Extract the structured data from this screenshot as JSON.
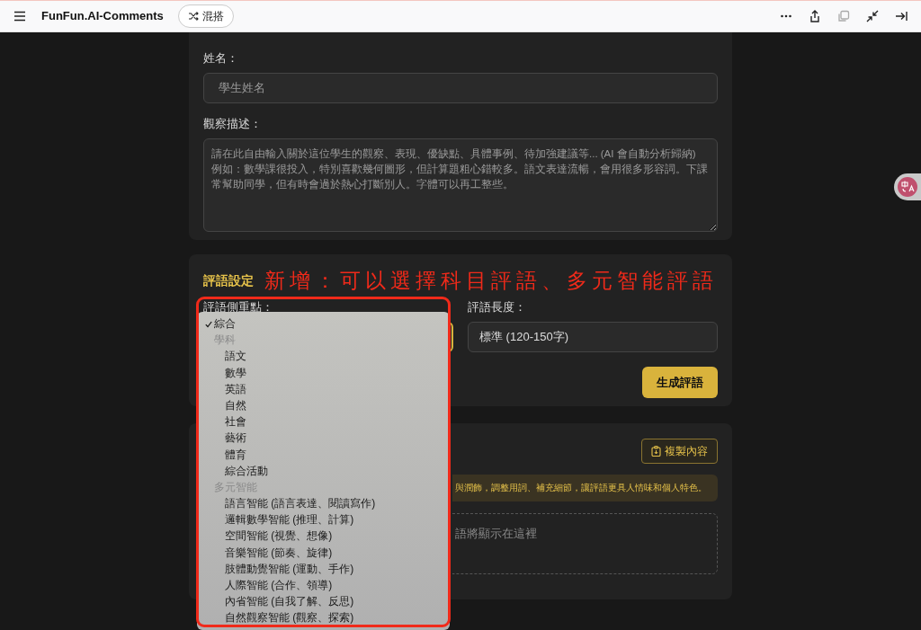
{
  "toolbar": {
    "title": "FunFun.AI-Comments",
    "mix_button": "混搭"
  },
  "student_card": {
    "name_label": "姓名：",
    "name_placeholder": "學生姓名",
    "observation_label": "觀察描述：",
    "observation_placeholder": "請在此自由輸入關於這位學生的觀察、表現、優缺點、具體事例、待加強建議等... (AI 會自動分析歸納)\n例如：數學課很投入，特別喜歡幾何圖形，但計算題粗心錯較多。語文表達流暢，會用很多形容詞。下課常幫助同學，但有時會過於熱心打斷別人。字體可以再工整些。"
  },
  "settings_card": {
    "title": "評語設定",
    "annotation": "新增：可以選擇科目評語、多元智能評語",
    "focus_label": "評語側重點：",
    "length_label": "評語長度：",
    "length_value": "標準 (120-150字)",
    "generate_button": "生成評語"
  },
  "focus_dropdown": {
    "items": [
      {
        "kind": "option",
        "label": "綜合",
        "selected": true
      },
      {
        "kind": "group",
        "label": "學科",
        "children": [
          {
            "label": "語文",
            "selected": false
          },
          {
            "label": "數學",
            "selected": false
          },
          {
            "label": "英語",
            "selected": false
          },
          {
            "label": "自然",
            "selected": false
          },
          {
            "label": "社會",
            "selected": false
          },
          {
            "label": "藝術",
            "selected": false
          },
          {
            "label": "體育",
            "selected": false
          },
          {
            "label": "綜合活動",
            "selected": false
          }
        ]
      },
      {
        "kind": "group",
        "label": "多元智能",
        "children": [
          {
            "label": "語言智能 (語言表達、閱讀寫作)",
            "selected": false
          },
          {
            "label": "邏輯數學智能 (推理、計算)",
            "selected": false
          },
          {
            "label": "空間智能 (視覺、想像)",
            "selected": false
          },
          {
            "label": "音樂智能 (節奏、旋律)",
            "selected": false
          },
          {
            "label": "肢體動覺智能 (運動、手作)",
            "selected": false
          },
          {
            "label": "人際智能 (合作、領導)",
            "selected": false
          },
          {
            "label": "內省智能 (自我了解、反思)",
            "selected": false
          },
          {
            "label": "自然觀察智能 (觀察、探索)",
            "selected": false
          }
        ]
      }
    ]
  },
  "result_card": {
    "copy_button": "複製內容",
    "notice": "與潤飾，調整用詞、補充細節，讓評語更具人情味和個人特色。",
    "placeholder": "語將顯示在這裡"
  }
}
